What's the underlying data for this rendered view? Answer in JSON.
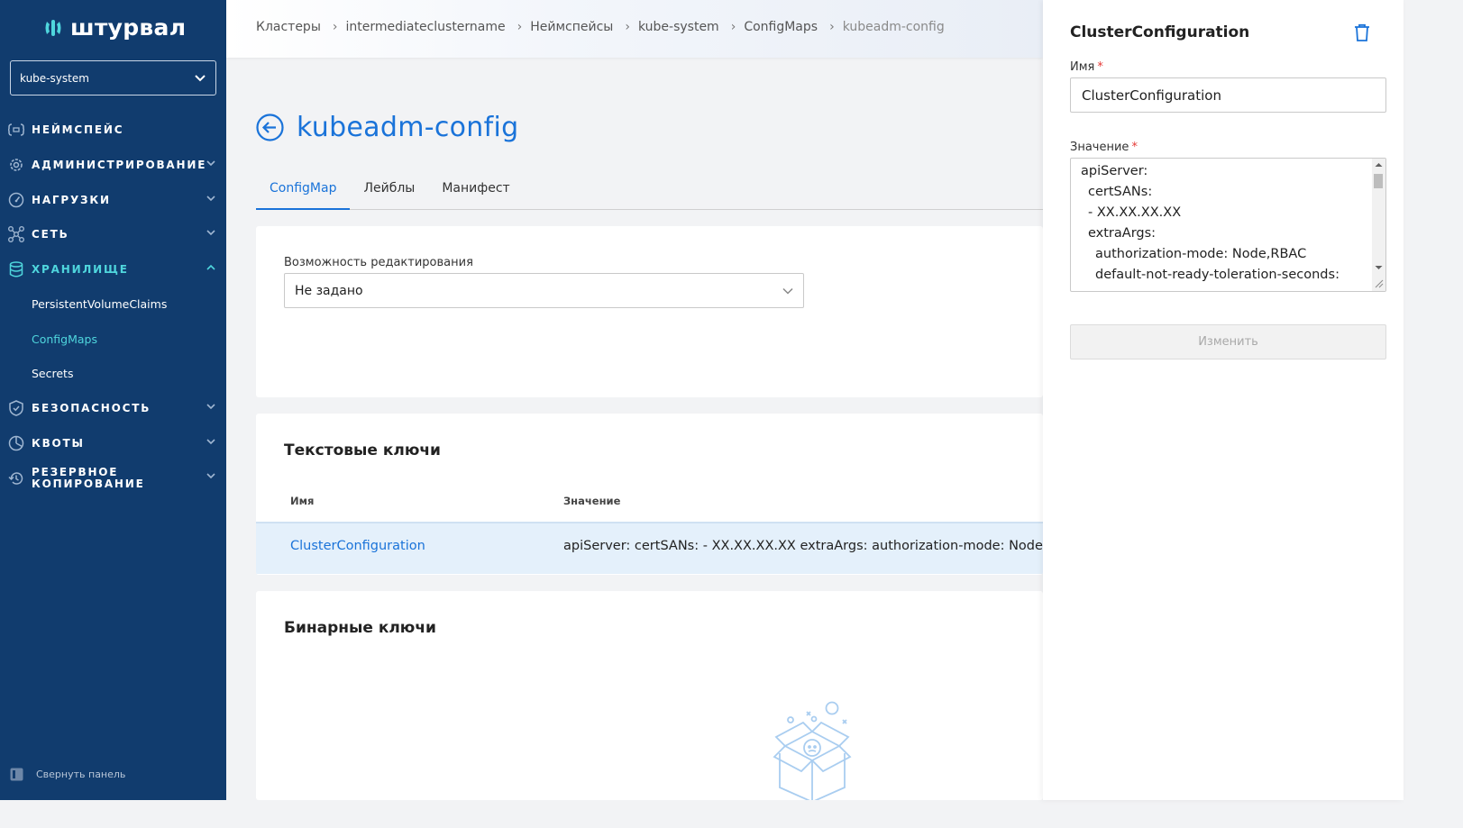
{
  "sidebar": {
    "logo_text": "штурвал",
    "namespace": "kube-system",
    "items": [
      {
        "label": "НЕЙМСПЕЙС",
        "icon": "namespace-icon"
      },
      {
        "label": "АДМИНИСТРИРОВАНИЕ",
        "icon": "gear-icon"
      },
      {
        "label": "НАГРУЗКИ",
        "icon": "gauge-icon"
      },
      {
        "label": "СЕТЬ",
        "icon": "network-icon"
      },
      {
        "label": "ХРАНИЛИЩЕ",
        "icon": "database-icon"
      },
      {
        "label": "БЕЗОПАСНОСТЬ",
        "icon": "shield-icon"
      },
      {
        "label": "КВОТЫ",
        "icon": "pie-chart-icon"
      },
      {
        "label_line1": "РЕЗЕРВНОЕ",
        "label_line2": "КОПИРОВАНИЕ",
        "icon": "backup-icon"
      }
    ],
    "storage_sub": [
      "PersistentVolumeClaims",
      "ConfigMaps",
      "Secrets"
    ],
    "collapse_label": "Свернуть панель"
  },
  "breadcrumb": [
    "Кластеры",
    "intermediateclustername",
    "Неймспейсы",
    "kube-system",
    "ConfigMaps",
    "kubeadm-config"
  ],
  "page": {
    "title": "kubeadm-config",
    "tabs": [
      "ConfigMap",
      "Лейблы",
      "Манифест"
    ]
  },
  "edit_card": {
    "label": "Возможность редактирования",
    "value": "Не задано"
  },
  "text_keys": {
    "title": "Текстовые ключи",
    "col_name": "Имя",
    "col_value": "Значение",
    "rows": [
      {
        "name": "ClusterConfiguration",
        "value": "apiServer: certSANs: - XX.XX.XX.XX extraArgs: authorization-mode: Node,RBAC default-not-ready-toleration-seconds:"
      }
    ]
  },
  "binary_keys": {
    "title": "Бинарные ключи"
  },
  "panel": {
    "title": "ClusterConfiguration",
    "name_label": "Имя",
    "name_value": "ClusterConfiguration",
    "value_label": "Значение",
    "value_lines": [
      "apiServer:",
      "  certSANs:",
      "  - XX.XX.XX.XX",
      "  extraArgs:",
      "    authorization-mode: Node,RBAC",
      "    default-not-ready-toleration-seconds:"
    ],
    "submit_label": "Изменить"
  },
  "colors": {
    "sidebar_bg": "#113c6e",
    "accent_cyan": "#4fd6dd",
    "link_blue": "#1a73d9",
    "required_red": "#e53935"
  }
}
